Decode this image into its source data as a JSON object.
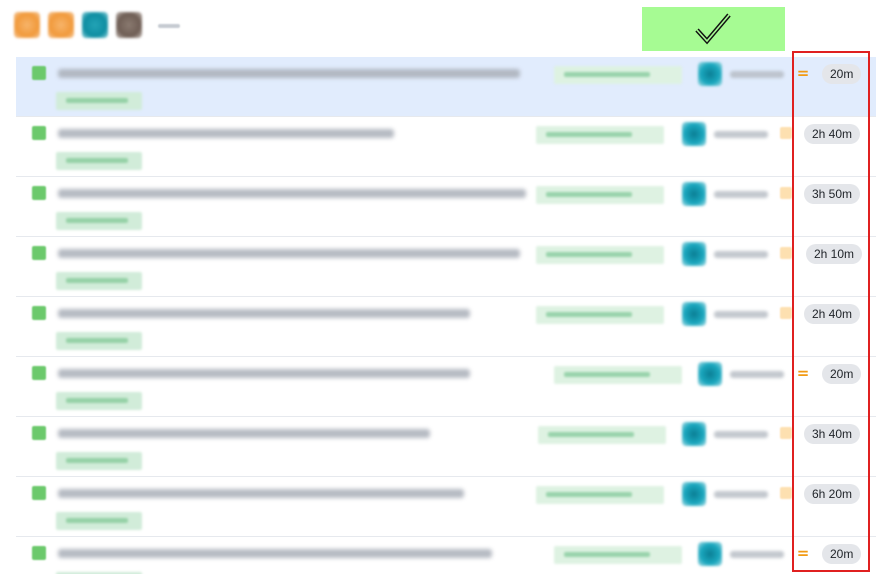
{
  "toolbar": {
    "collaborators": [
      {
        "icon": "avatar-orange"
      },
      {
        "icon": "avatar-orange"
      },
      {
        "icon": "avatar-teal"
      },
      {
        "icon": "avatar-brown"
      }
    ],
    "more_icon": "ellipsis-icon",
    "approve_icon": "checkmark-icon",
    "approve_color": "#a6fb93"
  },
  "colors": {
    "selected_row": "#e1ecfd",
    "priority": "#f29a12",
    "badge_bg": "#e4e6ea",
    "highlight": "#e02020"
  },
  "tasks": [
    {
      "selected": true,
      "priority_icon": "=",
      "time": "20m"
    },
    {
      "selected": false,
      "priority_icon": "",
      "time": "2h 40m"
    },
    {
      "selected": false,
      "priority_icon": "",
      "time": "3h 50m"
    },
    {
      "selected": false,
      "priority_icon": "",
      "time": "2h 10m"
    },
    {
      "selected": false,
      "priority_icon": "",
      "time": "2h 40m"
    },
    {
      "selected": false,
      "priority_icon": "=",
      "time": "20m"
    },
    {
      "selected": false,
      "priority_icon": "",
      "time": "3h 40m"
    },
    {
      "selected": false,
      "priority_icon": "",
      "time": "6h 20m"
    },
    {
      "selected": false,
      "priority_icon": "=",
      "time": "20m"
    }
  ]
}
